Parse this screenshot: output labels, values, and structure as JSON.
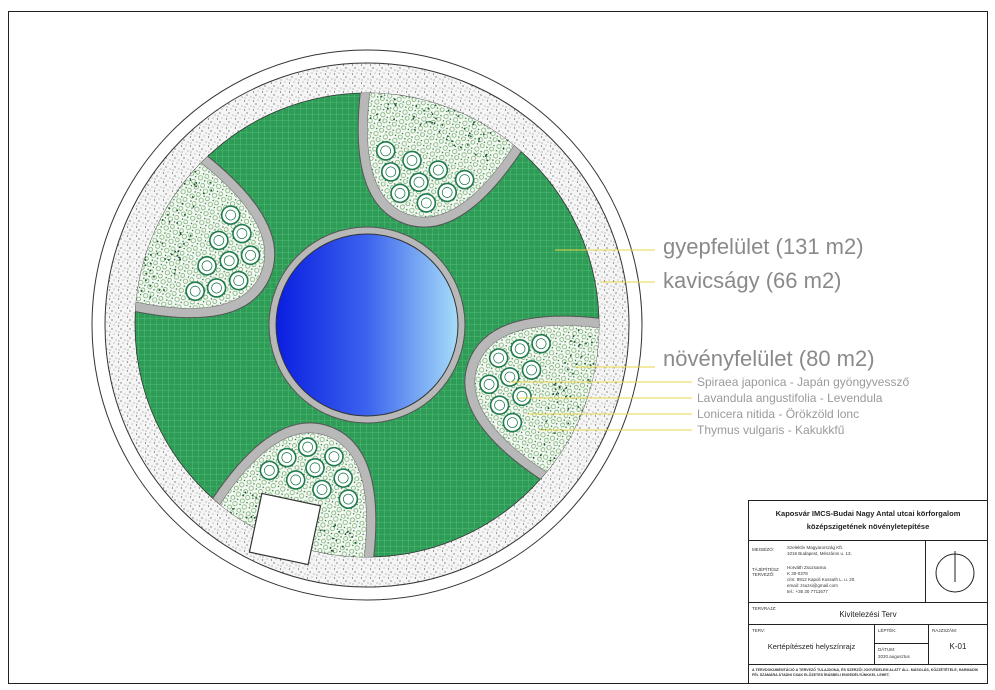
{
  "labels": {
    "grass": "gyepfelület (131 m2)",
    "gravel": "kavicságy (66 m2)",
    "plants": "növényfelület (80 m2)",
    "species": [
      "Spiraea japonica - Japán gyöngyvessző",
      "Lavandula angustifolia - Levendula",
      "Lonicera nitida - Örökzöld lonc",
      "Thymus vulgaris - Kakukkfű"
    ]
  },
  "colors": {
    "grass": "#2e9b57",
    "grass_light": "#4dbb74",
    "gravel": "#f5f5f5",
    "path": "#b8b8b8",
    "water_dark": "#0a1ee0",
    "water_light": "#a6dcf8",
    "shrub": "#1f7a4d",
    "leader": "#e9d64a"
  },
  "title_block": {
    "title_line1": "Kaposvár IMCS-Budai Nagy Antal utcai körforgalom",
    "title_line2": "középszigetének növényletepítése",
    "client_label": "MEGBÍZÓ:",
    "client_value": [
      "Szelektív Magyarország Kft.",
      "1016 Budapest, Mészáros u. 13."
    ],
    "designer_label": "TÁJÉPÍTÉSZ TERVEZŐ:",
    "designer_value": [
      "Horváth Zsuzsanna",
      "K 30-0378",
      "cím: 8912 Kapoli Kossuth L. u. 20.",
      "email: zsuzsi@gmail.com",
      "tel.: +36 30 7711677"
    ],
    "drawer_label": "TERVRAJZ:",
    "plan_type": "Kivitelezési Terv",
    "sheet_label": "TERV:",
    "sheet_name": "Kertépítészeti helyszínrajz",
    "scale_label": "LÉPTÉK:",
    "date_label": "DÁTUM:",
    "date_value": "2020.augusztus",
    "drawing_no_label": "RAJZSZÁM:",
    "drawing_no": "K-01",
    "footer": "A TERVDOKUMENTÁCIÓ A TERVEZŐ TULAJDONA, ÉS SZERZŐI JOGVÉDELEM ALATT ÁLL. MÁSOLÁS, KÖZZÉTÉTELE, HARMADIK FÉL SZÁMÁRA ÁTADNI CSAK ELŐZETES ÍRÁSBELI ENGEDÉLYÜNKKEL LEHET."
  }
}
